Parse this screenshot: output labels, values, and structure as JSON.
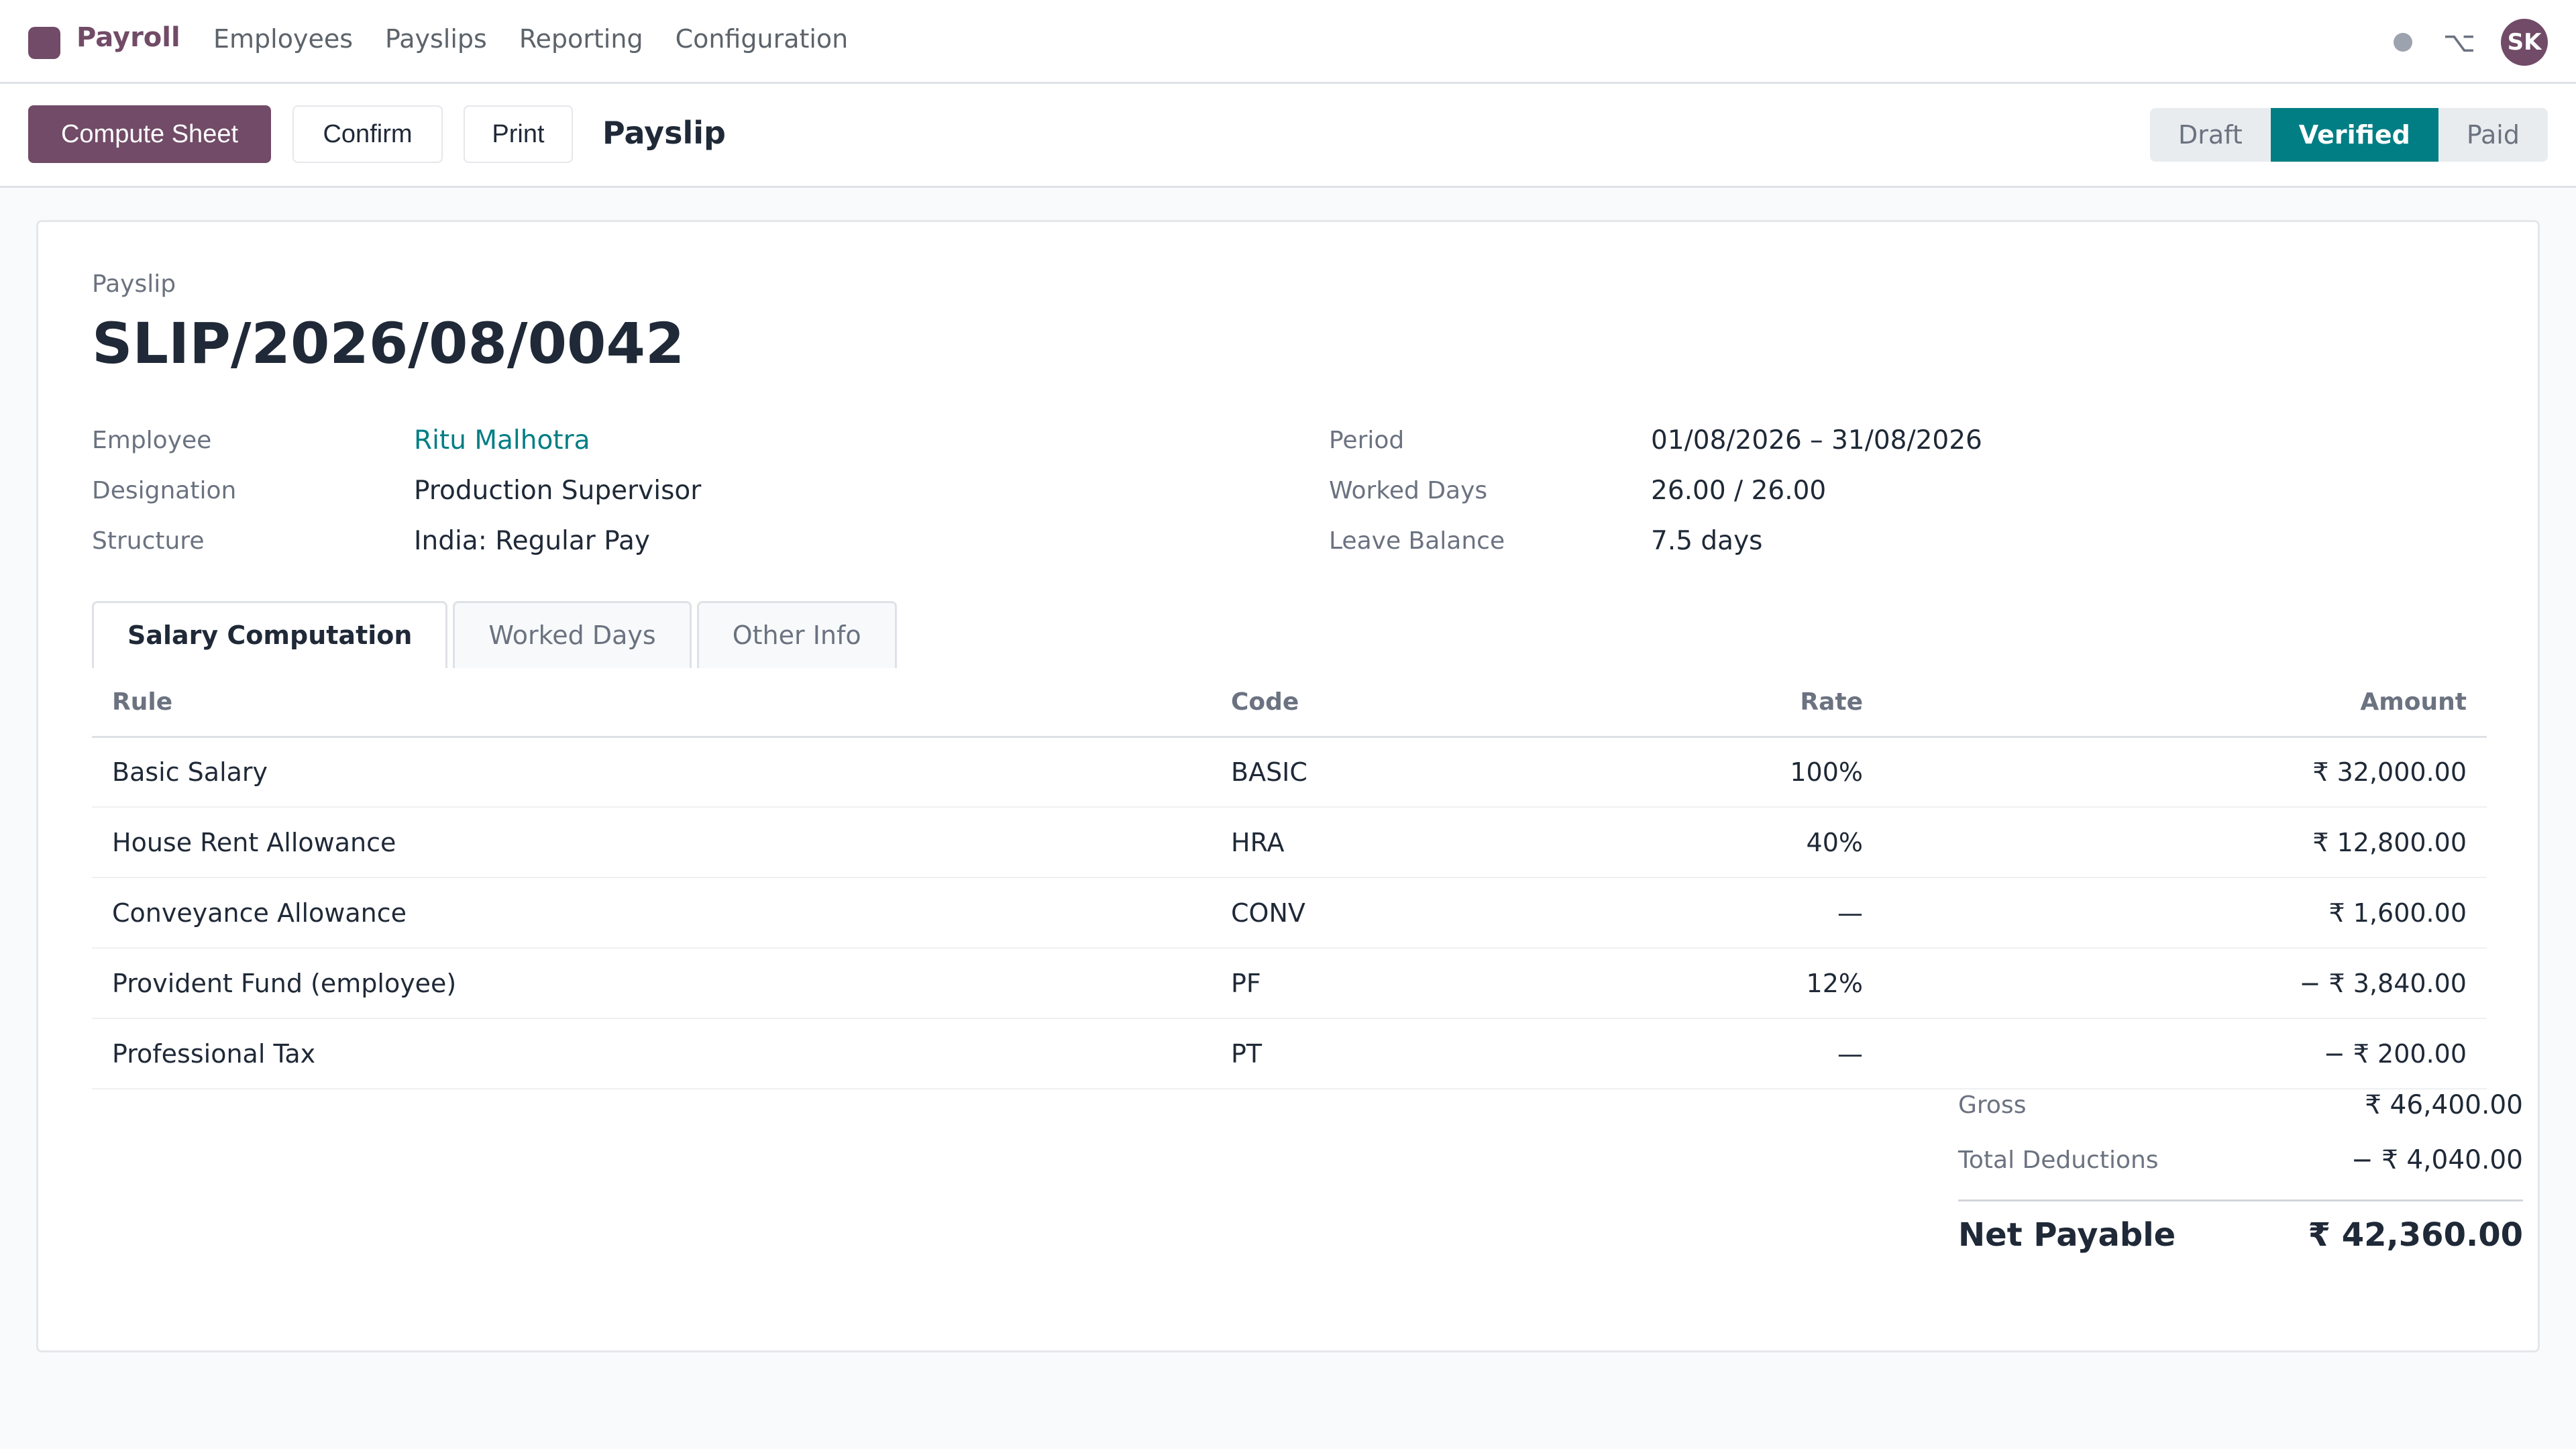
{
  "app": {
    "name": "Payroll",
    "menu": [
      "Employees",
      "Payslips",
      "Reporting",
      "Configuration"
    ],
    "user_initials": "SK",
    "brand_color": "#714b67",
    "accent_color": "#017e84"
  },
  "control": {
    "compute_label": "Compute Sheet",
    "confirm_label": "Confirm",
    "print_label": "Print",
    "breadcrumb": "Payslip",
    "status_steps": [
      "Draft",
      "Verified",
      "Paid"
    ],
    "current_status": "Verified"
  },
  "sheet": {
    "label": "Payslip",
    "number": "SLIP/2026/08/0042",
    "left_fields": [
      {
        "label": "Employee",
        "value": "Ritu Malhotra"
      },
      {
        "label": "Designation",
        "value": "Production Supervisor"
      },
      {
        "label": "Structure",
        "value": "India: Regular Pay"
      }
    ],
    "right_fields": [
      {
        "label": "Period",
        "value": "01/08/2026 – 31/08/2026"
      },
      {
        "label": "Worked Days",
        "value": "26.00 / 26.00"
      },
      {
        "label": "Leave Balance",
        "value": "7.5 days"
      }
    ],
    "tabs": [
      "Salary Computation",
      "Worked Days",
      "Other Info"
    ],
    "active_tab": "Salary Computation"
  },
  "table": {
    "headers": [
      "Rule",
      "Code",
      "Rate",
      "Amount"
    ],
    "rows": [
      {
        "rule": "Basic Salary",
        "code": "BASIC",
        "rate": "100%",
        "amount": "₹ 32,000.00"
      },
      {
        "rule": "House Rent Allowance",
        "code": "HRA",
        "rate": "40%",
        "amount": "₹ 12,800.00"
      },
      {
        "rule": "Conveyance Allowance",
        "code": "CONV",
        "rate": "—",
        "amount": "₹ 1,600.00"
      },
      {
        "rule": "Provident Fund (employee)",
        "code": "PF",
        "rate": "12%",
        "amount": "− ₹ 3,840.00"
      },
      {
        "rule": "Professional Tax",
        "code": "PT",
        "rate": "—",
        "amount": "− ₹ 200.00"
      }
    ]
  },
  "totals": {
    "gross_label": "Gross",
    "gross_value": "₹ 46,400.00",
    "deductions_label": "Total Deductions",
    "deductions_value": "− ₹ 4,040.00",
    "net_label": "Net Payable",
    "net_value": "₹ 42,360.00"
  }
}
